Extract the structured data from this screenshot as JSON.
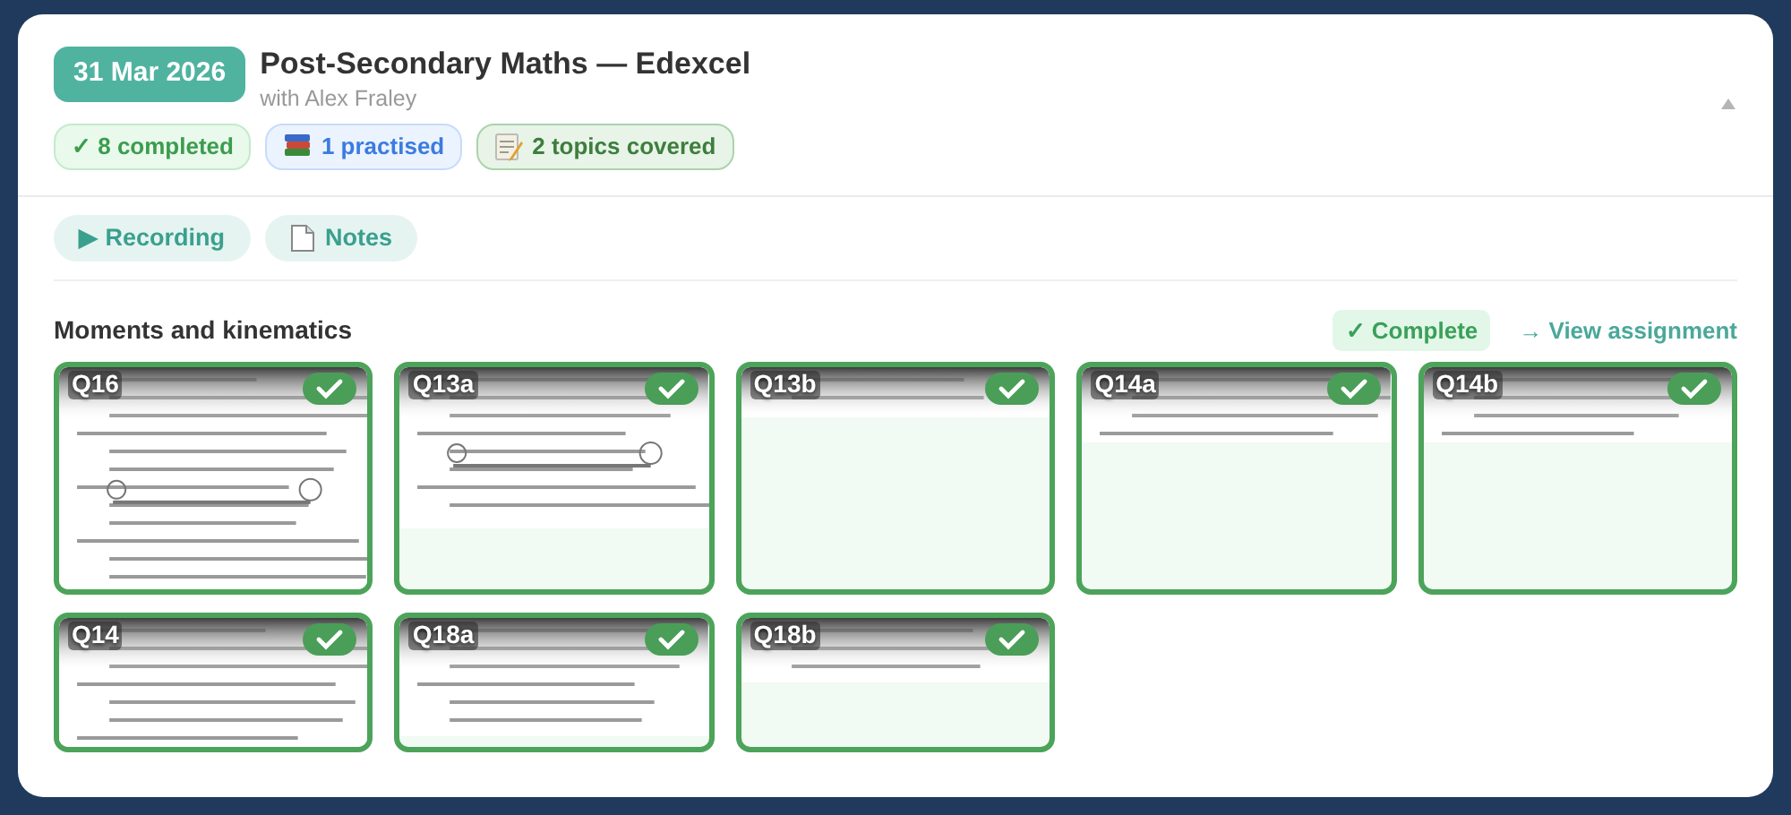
{
  "session": {
    "date": "31 Mar 2026",
    "title": "Post-Secondary Maths — Edexcel",
    "tutor": "with Alex Fraley",
    "expanded": true,
    "stats": [
      {
        "kind": "completed",
        "label": "✓ 8 completed"
      },
      {
        "kind": "practised",
        "label": "1 practised"
      },
      {
        "kind": "topics",
        "label": "2 topics covered"
      }
    ]
  },
  "actions": [
    {
      "kind": "recording",
      "label": "▶ Recording"
    },
    {
      "kind": "notes",
      "label": "Notes"
    }
  ],
  "topics": [
    {
      "title": "Moments and kinematics",
      "status": "✓ Complete",
      "link": "→ View assignment",
      "questions": [
        {
          "label": "Q16",
          "completed": true
        },
        {
          "label": "Q13a",
          "completed": true
        },
        {
          "label": "Q13b",
          "completed": true
        },
        {
          "label": "Q14a",
          "completed": true
        },
        {
          "label": "Q14b",
          "completed": true
        },
        {
          "label": "Q14",
          "completed": true
        },
        {
          "label": "Q18a",
          "completed": true
        },
        {
          "label": "Q18b",
          "completed": true
        }
      ]
    }
  ]
}
